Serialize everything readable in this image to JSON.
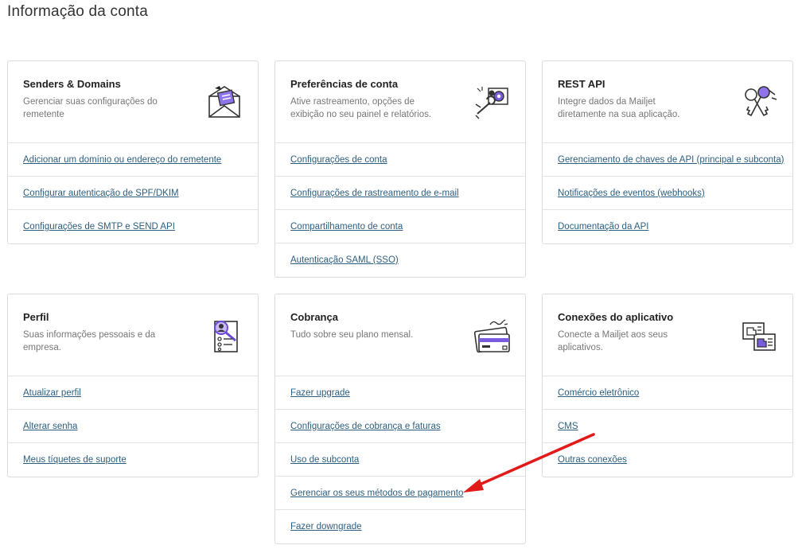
{
  "page_title": "Informação da conta",
  "cards": [
    {
      "title": "Senders & Domains",
      "desc": "Gerenciar suas configurações do remetente",
      "icon": "envelope-icon",
      "links": [
        "Adicionar um domínio ou endereço do remetente",
        "Configurar autenticação de SPF/DKIM",
        "Configurações de SMTP e SEND API"
      ]
    },
    {
      "title": "Preferências de conta",
      "desc": "Ative rastreamento, opções de exibição no seu painel e relatórios.",
      "icon": "wrench-gear-icon",
      "links": [
        "Configurações de conta",
        "Configurações de rastreamento de e-mail",
        "Compartilhamento de conta",
        "Autenticação SAML (SSO)"
      ]
    },
    {
      "title": "REST API",
      "desc": "Integre dados da Mailjet diretamente na sua aplicação.",
      "icon": "keys-icon",
      "links": [
        "Gerenciamento de chaves de API (principal e subconta)",
        "Notificações de eventos (webhooks)",
        "Documentação da API"
      ]
    },
    {
      "title": "Perfil",
      "desc": "Suas informações pessoais e da empresa.",
      "icon": "profile-search-icon",
      "links": [
        "Atualizar perfil",
        "Alterar senha",
        "Meus tíquetes de suporte"
      ]
    },
    {
      "title": "Cobrança",
      "desc": "Tudo sobre seu plano mensal.",
      "icon": "credit-card-icon",
      "links": [
        "Fazer upgrade",
        "Configurações de cobrança e faturas",
        "Uso de subconta",
        "Gerenciar os seus métodos de pagamento",
        "Fazer downgrade"
      ]
    },
    {
      "title": "Conexões do aplicativo",
      "desc": "Conecte a Mailjet aos seus aplicativos.",
      "icon": "app-connections-icon",
      "links": [
        "Comércio eletrônico",
        "CMS",
        "Outras conexões"
      ]
    }
  ],
  "colors": {
    "link": "#2c5f80",
    "accent_purple": "#6a4bd6",
    "annotation_arrow": "#e31a1a"
  }
}
